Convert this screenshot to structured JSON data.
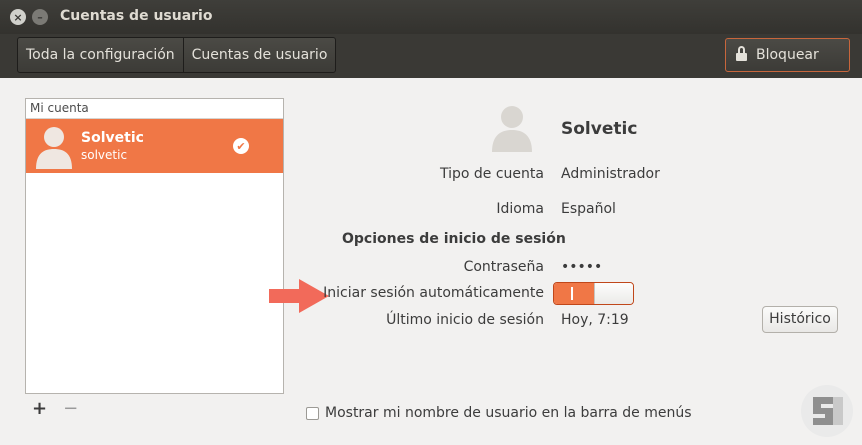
{
  "window": {
    "title": "Cuentas de usuario",
    "close_glyph": "×",
    "minimize_glyph": "–"
  },
  "toolbar": {
    "breadcrumbs": [
      "Toda la configuración",
      "Cuentas de usuario"
    ],
    "lock_label": "Bloquear"
  },
  "account_list": {
    "header": "Mi cuenta",
    "users": [
      {
        "name": "Solvetic",
        "login": "solvetic",
        "selected": true
      }
    ],
    "add_label": "+",
    "remove_label": "−"
  },
  "details": {
    "name": "Solvetic",
    "account_type_label": "Tipo de cuenta",
    "account_type_value": "Administrador",
    "language_label": "Idioma",
    "language_value": "Español",
    "login_options_title": "Opciones de inicio de sesión",
    "password_label": "Contraseña",
    "password_value": "•••••",
    "auto_login_label": "Iniciar sesión automáticamente",
    "auto_login_on": true,
    "last_login_label": "Último inicio de sesión",
    "last_login_value": "Hoy,  7:19",
    "history_button": "Histórico"
  },
  "footer": {
    "show_name_label": "Mostrar mi nombre de usuario en la barra de menús",
    "show_name_checked": false
  },
  "colors": {
    "accent": "#f07746",
    "annotation_arrow": "#f26a5a",
    "titlebar": "#3a3935",
    "content_bg": "#f2f1f0"
  },
  "icons": [
    "close-icon",
    "minimize-icon",
    "lock-icon",
    "avatar-icon",
    "check-icon",
    "arrow-annotation"
  ]
}
